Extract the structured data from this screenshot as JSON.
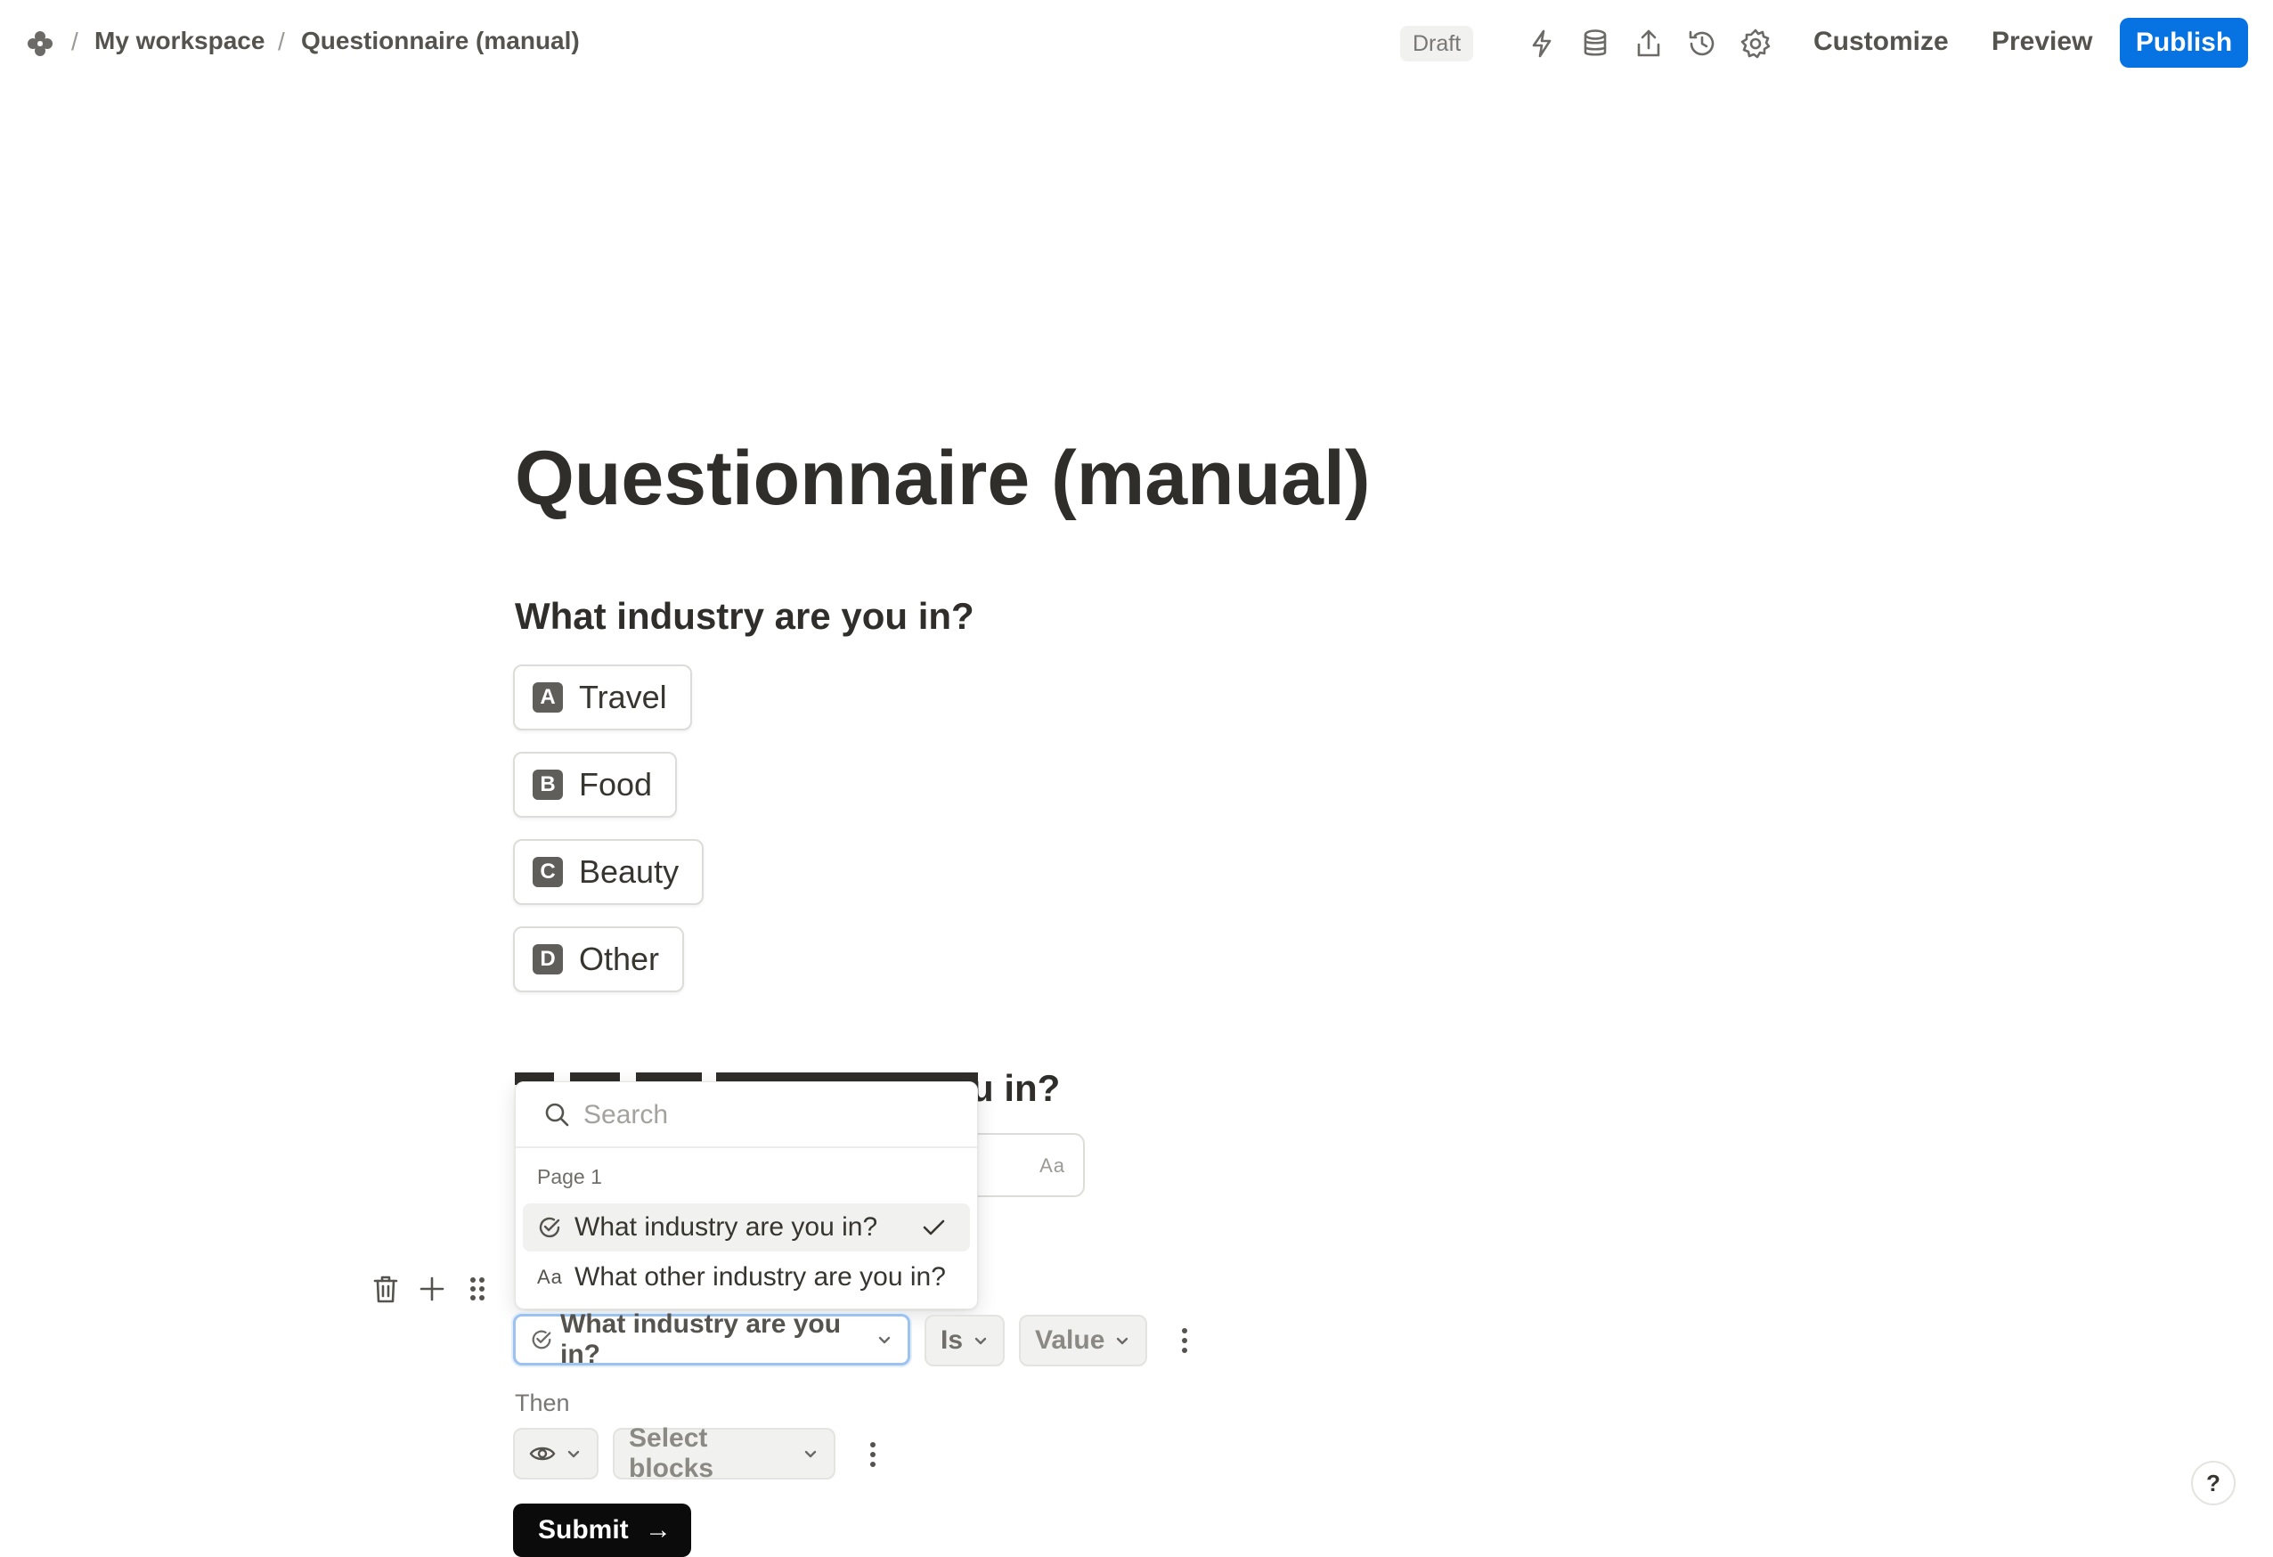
{
  "breadcrumb": {
    "workspace": "My workspace",
    "separator": "/",
    "page": "Questionnaire (manual)"
  },
  "topbar": {
    "status": "Draft",
    "customize": "Customize",
    "preview": "Preview",
    "publish": "Publish",
    "icons": [
      "logo-icon",
      "lightning-icon",
      "database-icon",
      "share-icon",
      "history-icon",
      "settings-icon"
    ]
  },
  "form": {
    "title": "Questionnaire (manual)",
    "question1": {
      "label": "What industry are you in?",
      "options": [
        {
          "key": "A",
          "label": "Travel"
        },
        {
          "key": "B",
          "label": "Food"
        },
        {
          "key": "C",
          "label": "Beauty"
        },
        {
          "key": "D",
          "label": "Other"
        }
      ]
    },
    "question2": {
      "label_visible_fragment": "u in?",
      "field_type_icon": "Aa"
    },
    "submit": "Submit"
  },
  "dropdown": {
    "search_placeholder": "Search",
    "section": "Page 1",
    "items": [
      {
        "label": "What industry are you in?",
        "icon": "check-circle-icon",
        "selected": true
      },
      {
        "label": "What other industry are you in?",
        "icon": "Aa",
        "selected": false
      }
    ]
  },
  "logic": {
    "condition_field": "What industry are you in?",
    "operator": "Is",
    "value": "Value",
    "then_label": "Then",
    "action_blocks": "Select blocks"
  },
  "help": "?",
  "colors": {
    "accent": "#0773e2",
    "text": "#37352f",
    "muted": "#787774",
    "focus_border": "#9cc2ef"
  }
}
